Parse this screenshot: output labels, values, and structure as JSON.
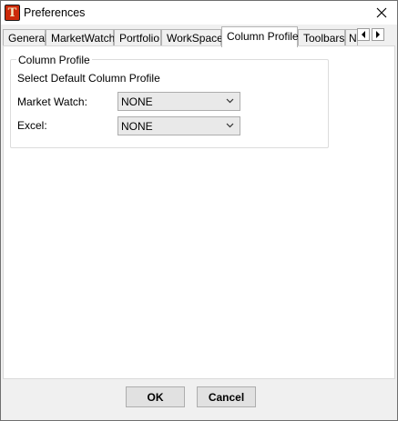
{
  "window": {
    "title": "Preferences",
    "app_icon_letter": "T",
    "icons": {
      "app": "app-logo-icon",
      "close": "close-icon"
    }
  },
  "tabs": [
    {
      "label": "General",
      "active": false
    },
    {
      "label": "MarketWatch",
      "active": false
    },
    {
      "label": "Portfolio",
      "active": false
    },
    {
      "label": "WorkSpace",
      "active": false
    },
    {
      "label": "Column Profile",
      "active": true
    },
    {
      "label": "Toolbars",
      "active": false
    },
    {
      "label": "N",
      "active": false
    }
  ],
  "tab_scroll": {
    "left_icon": "arrow-left-icon",
    "right_icon": "arrow-right-icon"
  },
  "panel": {
    "group_title": "Column Profile",
    "instruction": "Select Default Column Profile",
    "fields": [
      {
        "label": "Market Watch:",
        "value": "NONE"
      },
      {
        "label": "Excel:",
        "value": "NONE"
      }
    ]
  },
  "buttons": {
    "ok": "OK",
    "cancel": "Cancel"
  },
  "colors": {
    "app_icon": "#cc2a0a",
    "window_bg": "#f0f0f0",
    "panel_bg": "#ffffff"
  }
}
